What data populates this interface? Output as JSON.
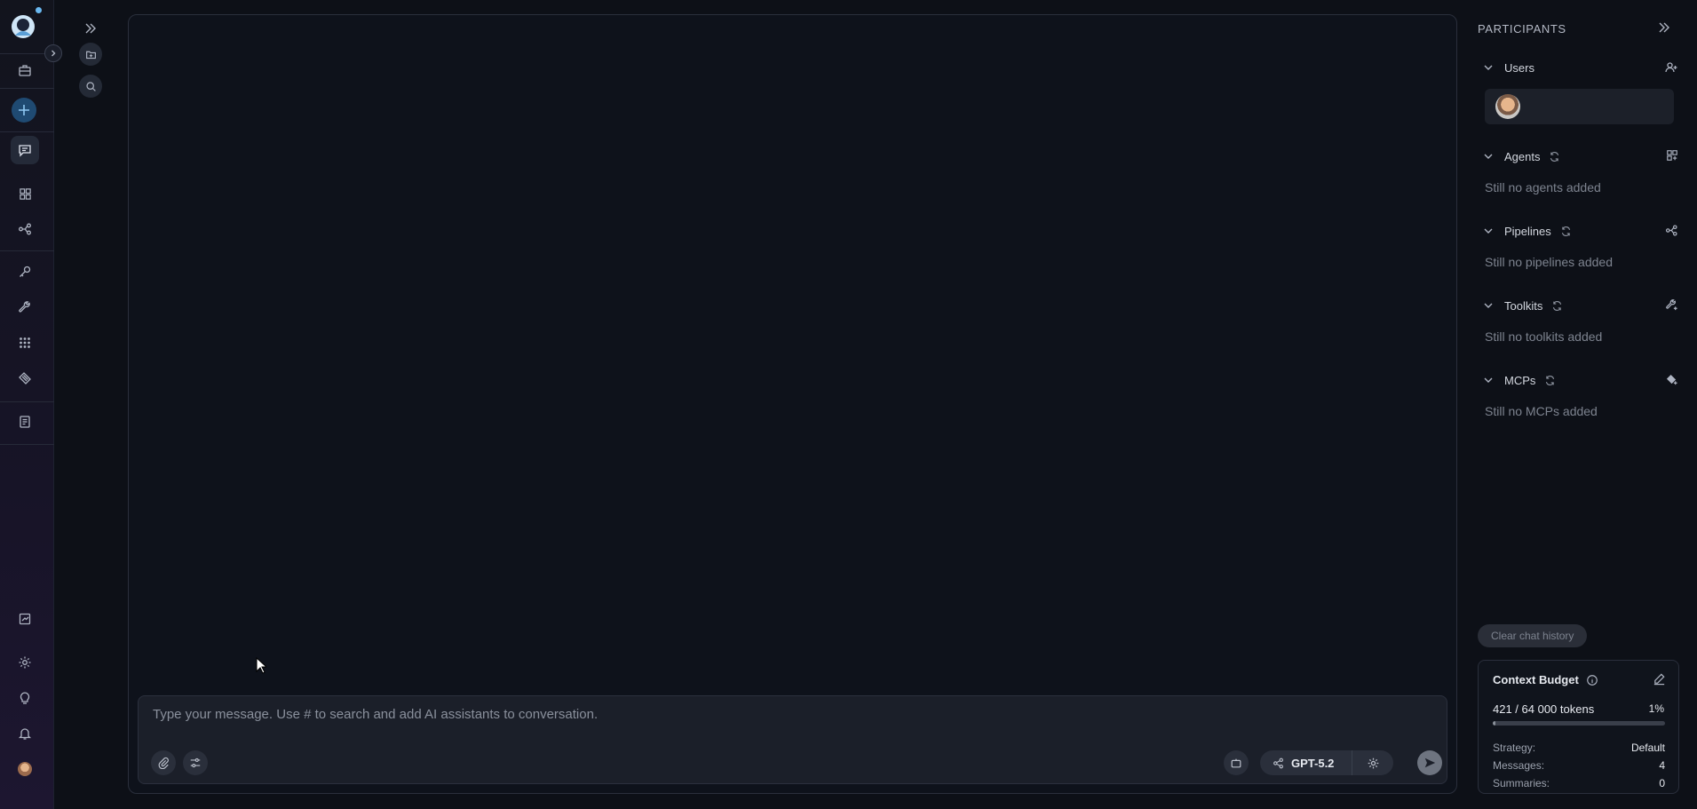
{
  "nav": {
    "icons": [
      "logo",
      "briefcase-icon",
      "plus-icon",
      "chat-icon",
      "grid-icon",
      "flow-icon",
      "key-icon",
      "wrench-icon",
      "apps-icon",
      "ticket-icon",
      "document-icon",
      "notes-icon",
      "gear-icon",
      "lightbulb-icon",
      "bell-icon",
      "avatar"
    ],
    "active": "chat-icon"
  },
  "composer": {
    "placeholder": "Type your message. Use # to search and add AI assistants to conversation.",
    "value": "",
    "model": "GPT-5.2"
  },
  "participants": {
    "title": "PARTICIPANTS",
    "sections": {
      "users": {
        "label": "Users"
      },
      "agents": {
        "label": "Agents",
        "empty": "Still no agents added"
      },
      "pipelines": {
        "label": "Pipelines",
        "empty": "Still no pipelines added"
      },
      "toolkits": {
        "label": "Toolkits",
        "empty": "Still no toolkits added"
      },
      "mcps": {
        "label": "MCPs",
        "empty": "Still no MCPs added"
      }
    },
    "clear_label": "Clear chat history"
  },
  "budget": {
    "title": "Context Budget",
    "tokens": "421 / 64 000 tokens",
    "percent": "1%",
    "fill_fraction": 0.01,
    "strategy_label": "Strategy:",
    "strategy_value": "Default",
    "messages_label": "Messages:",
    "messages_value": "4",
    "summaries_label": "Summaries:",
    "summaries_value": "0"
  },
  "colors": {
    "background": "#0d1017",
    "panel": "#1b1f29",
    "accent": "#1f4a72"
  }
}
